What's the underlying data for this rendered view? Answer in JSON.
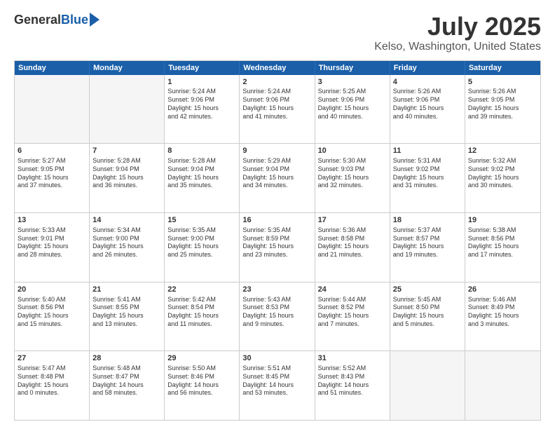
{
  "header": {
    "logo_general": "General",
    "logo_blue": "Blue",
    "main_title": "July 2025",
    "subtitle": "Kelso, Washington, United States"
  },
  "calendar": {
    "days": [
      "Sunday",
      "Monday",
      "Tuesday",
      "Wednesday",
      "Thursday",
      "Friday",
      "Saturday"
    ],
    "rows": [
      [
        {
          "num": "",
          "empty": true,
          "lines": []
        },
        {
          "num": "",
          "empty": true,
          "lines": []
        },
        {
          "num": "1",
          "empty": false,
          "lines": [
            "Sunrise: 5:24 AM",
            "Sunset: 9:06 PM",
            "Daylight: 15 hours",
            "and 42 minutes."
          ]
        },
        {
          "num": "2",
          "empty": false,
          "lines": [
            "Sunrise: 5:24 AM",
            "Sunset: 9:06 PM",
            "Daylight: 15 hours",
            "and 41 minutes."
          ]
        },
        {
          "num": "3",
          "empty": false,
          "lines": [
            "Sunrise: 5:25 AM",
            "Sunset: 9:06 PM",
            "Daylight: 15 hours",
            "and 40 minutes."
          ]
        },
        {
          "num": "4",
          "empty": false,
          "lines": [
            "Sunrise: 5:26 AM",
            "Sunset: 9:06 PM",
            "Daylight: 15 hours",
            "and 40 minutes."
          ]
        },
        {
          "num": "5",
          "empty": false,
          "lines": [
            "Sunrise: 5:26 AM",
            "Sunset: 9:05 PM",
            "Daylight: 15 hours",
            "and 39 minutes."
          ]
        }
      ],
      [
        {
          "num": "6",
          "empty": false,
          "lines": [
            "Sunrise: 5:27 AM",
            "Sunset: 9:05 PM",
            "Daylight: 15 hours",
            "and 37 minutes."
          ]
        },
        {
          "num": "7",
          "empty": false,
          "lines": [
            "Sunrise: 5:28 AM",
            "Sunset: 9:04 PM",
            "Daylight: 15 hours",
            "and 36 minutes."
          ]
        },
        {
          "num": "8",
          "empty": false,
          "lines": [
            "Sunrise: 5:28 AM",
            "Sunset: 9:04 PM",
            "Daylight: 15 hours",
            "and 35 minutes."
          ]
        },
        {
          "num": "9",
          "empty": false,
          "lines": [
            "Sunrise: 5:29 AM",
            "Sunset: 9:04 PM",
            "Daylight: 15 hours",
            "and 34 minutes."
          ]
        },
        {
          "num": "10",
          "empty": false,
          "lines": [
            "Sunrise: 5:30 AM",
            "Sunset: 9:03 PM",
            "Daylight: 15 hours",
            "and 32 minutes."
          ]
        },
        {
          "num": "11",
          "empty": false,
          "lines": [
            "Sunrise: 5:31 AM",
            "Sunset: 9:02 PM",
            "Daylight: 15 hours",
            "and 31 minutes."
          ]
        },
        {
          "num": "12",
          "empty": false,
          "lines": [
            "Sunrise: 5:32 AM",
            "Sunset: 9:02 PM",
            "Daylight: 15 hours",
            "and 30 minutes."
          ]
        }
      ],
      [
        {
          "num": "13",
          "empty": false,
          "lines": [
            "Sunrise: 5:33 AM",
            "Sunset: 9:01 PM",
            "Daylight: 15 hours",
            "and 28 minutes."
          ]
        },
        {
          "num": "14",
          "empty": false,
          "lines": [
            "Sunrise: 5:34 AM",
            "Sunset: 9:00 PM",
            "Daylight: 15 hours",
            "and 26 minutes."
          ]
        },
        {
          "num": "15",
          "empty": false,
          "lines": [
            "Sunrise: 5:35 AM",
            "Sunset: 9:00 PM",
            "Daylight: 15 hours",
            "and 25 minutes."
          ]
        },
        {
          "num": "16",
          "empty": false,
          "lines": [
            "Sunrise: 5:35 AM",
            "Sunset: 8:59 PM",
            "Daylight: 15 hours",
            "and 23 minutes."
          ]
        },
        {
          "num": "17",
          "empty": false,
          "lines": [
            "Sunrise: 5:36 AM",
            "Sunset: 8:58 PM",
            "Daylight: 15 hours",
            "and 21 minutes."
          ]
        },
        {
          "num": "18",
          "empty": false,
          "lines": [
            "Sunrise: 5:37 AM",
            "Sunset: 8:57 PM",
            "Daylight: 15 hours",
            "and 19 minutes."
          ]
        },
        {
          "num": "19",
          "empty": false,
          "lines": [
            "Sunrise: 5:38 AM",
            "Sunset: 8:56 PM",
            "Daylight: 15 hours",
            "and 17 minutes."
          ]
        }
      ],
      [
        {
          "num": "20",
          "empty": false,
          "lines": [
            "Sunrise: 5:40 AM",
            "Sunset: 8:56 PM",
            "Daylight: 15 hours",
            "and 15 minutes."
          ]
        },
        {
          "num": "21",
          "empty": false,
          "lines": [
            "Sunrise: 5:41 AM",
            "Sunset: 8:55 PM",
            "Daylight: 15 hours",
            "and 13 minutes."
          ]
        },
        {
          "num": "22",
          "empty": false,
          "lines": [
            "Sunrise: 5:42 AM",
            "Sunset: 8:54 PM",
            "Daylight: 15 hours",
            "and 11 minutes."
          ]
        },
        {
          "num": "23",
          "empty": false,
          "lines": [
            "Sunrise: 5:43 AM",
            "Sunset: 8:53 PM",
            "Daylight: 15 hours",
            "and 9 minutes."
          ]
        },
        {
          "num": "24",
          "empty": false,
          "lines": [
            "Sunrise: 5:44 AM",
            "Sunset: 8:52 PM",
            "Daylight: 15 hours",
            "and 7 minutes."
          ]
        },
        {
          "num": "25",
          "empty": false,
          "lines": [
            "Sunrise: 5:45 AM",
            "Sunset: 8:50 PM",
            "Daylight: 15 hours",
            "and 5 minutes."
          ]
        },
        {
          "num": "26",
          "empty": false,
          "lines": [
            "Sunrise: 5:46 AM",
            "Sunset: 8:49 PM",
            "Daylight: 15 hours",
            "and 3 minutes."
          ]
        }
      ],
      [
        {
          "num": "27",
          "empty": false,
          "lines": [
            "Sunrise: 5:47 AM",
            "Sunset: 8:48 PM",
            "Daylight: 15 hours",
            "and 0 minutes."
          ]
        },
        {
          "num": "28",
          "empty": false,
          "lines": [
            "Sunrise: 5:48 AM",
            "Sunset: 8:47 PM",
            "Daylight: 14 hours",
            "and 58 minutes."
          ]
        },
        {
          "num": "29",
          "empty": false,
          "lines": [
            "Sunrise: 5:50 AM",
            "Sunset: 8:46 PM",
            "Daylight: 14 hours",
            "and 56 minutes."
          ]
        },
        {
          "num": "30",
          "empty": false,
          "lines": [
            "Sunrise: 5:51 AM",
            "Sunset: 8:45 PM",
            "Daylight: 14 hours",
            "and 53 minutes."
          ]
        },
        {
          "num": "31",
          "empty": false,
          "lines": [
            "Sunrise: 5:52 AM",
            "Sunset: 8:43 PM",
            "Daylight: 14 hours",
            "and 51 minutes."
          ]
        },
        {
          "num": "",
          "empty": true,
          "lines": []
        },
        {
          "num": "",
          "empty": true,
          "lines": []
        }
      ]
    ]
  }
}
